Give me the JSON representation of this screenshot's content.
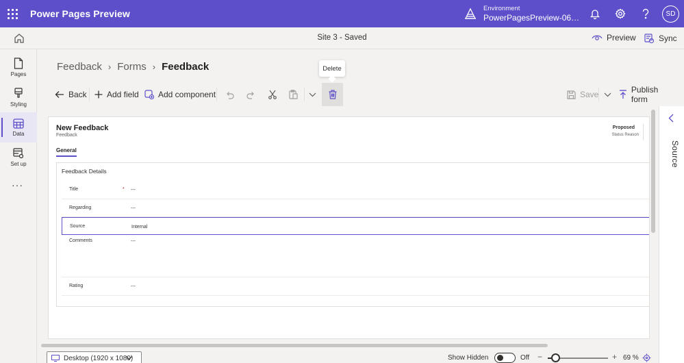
{
  "header": {
    "app_title": "Power Pages Preview",
    "environment_label": "Environment",
    "environment_value": "PowerPagesPreview-06…",
    "avatar_initials": "SD"
  },
  "subbar": {
    "site_status": "Site 3 - Saved",
    "preview_label": "Preview",
    "sync_label": "Sync"
  },
  "rail": {
    "items": [
      {
        "label": "Pages"
      },
      {
        "label": "Styling"
      },
      {
        "label": "Data"
      },
      {
        "label": "Set up"
      }
    ],
    "more": "···"
  },
  "breadcrumb": {
    "items": [
      "Feedback",
      "Forms"
    ],
    "current": "Feedback"
  },
  "tooltip": {
    "text": "Delete"
  },
  "toolbar": {
    "back_label": "Back",
    "add_field_label": "Add field",
    "add_component_label": "Add component",
    "save_label": "Save",
    "publish_label": "Publish form"
  },
  "form": {
    "title": "New Feedback",
    "subtitle": "Feedback",
    "status_value": "Proposed",
    "status_label": "Status Reason",
    "tab": "General",
    "section_title": "Feedback Details",
    "fields": [
      {
        "label": "Title",
        "required": "*",
        "value": "---"
      },
      {
        "label": "Regarding",
        "value": "---"
      },
      {
        "label": "Source",
        "value": "Internal"
      },
      {
        "label": "Comments",
        "value": "---"
      },
      {
        "label": "Rating",
        "value": "---"
      }
    ]
  },
  "source_panel": {
    "label": "Source"
  },
  "bottom": {
    "device": "Desktop (1920 x 1080)",
    "show_hidden_label": "Show Hidden",
    "toggle_state": "Off",
    "zoom_minus": "−",
    "zoom_plus": "+",
    "zoom_value": "69 %",
    "zoom_level": 0.69
  },
  "colors": {
    "brand": "#5c4fc9",
    "selected_border": "#5c4fc9"
  }
}
